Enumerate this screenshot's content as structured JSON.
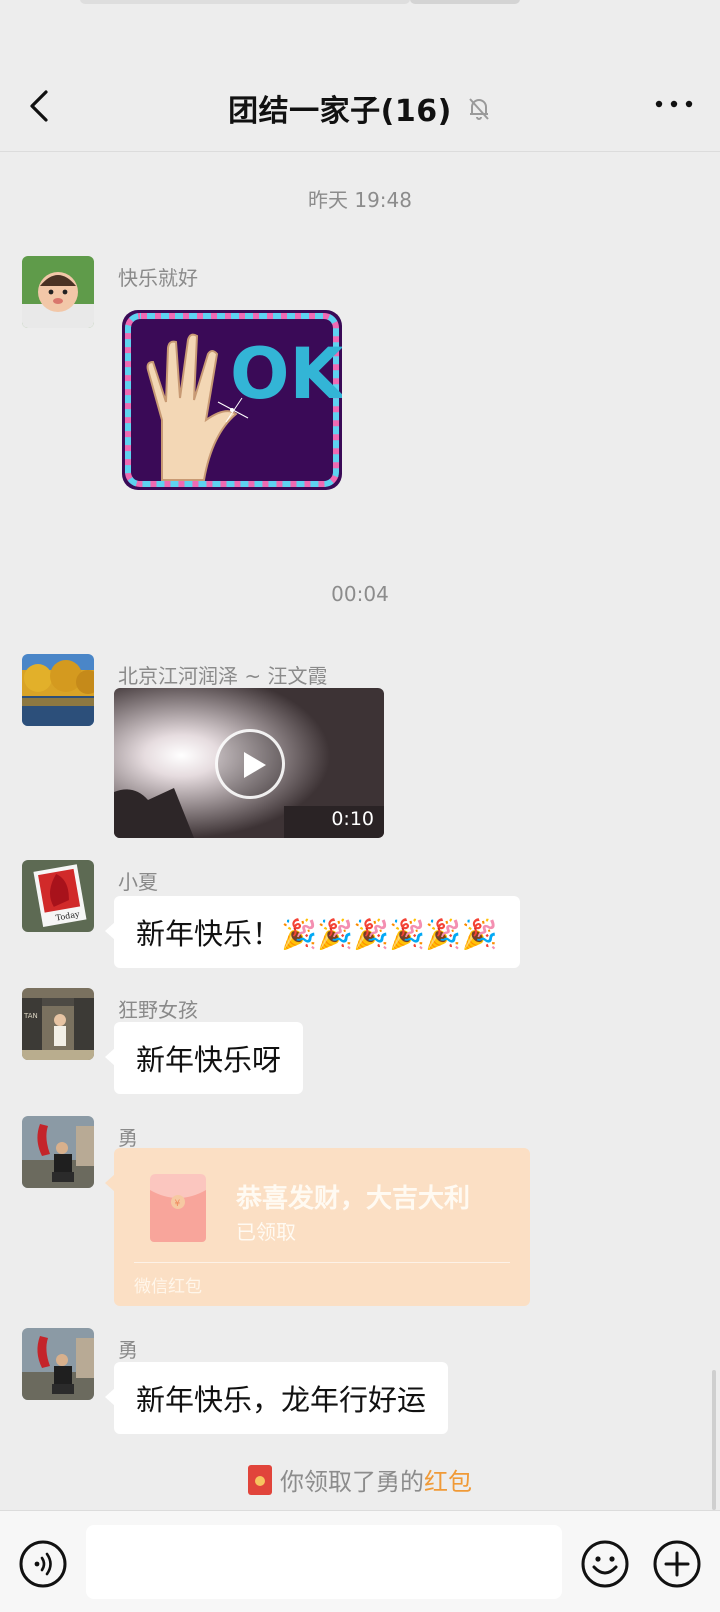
{
  "header": {
    "title": "团结一家子(16)",
    "icons": {
      "back": "chevron-left-icon",
      "mute": "bell-slash-icon",
      "more": "more-horizontal-icon"
    }
  },
  "messages": {
    "timestamp_1": "昨天 19:48",
    "msg1": {
      "sender": "快乐就好",
      "type": "sticker",
      "sticker_text": "OK"
    },
    "timestamp_2": "00:04",
    "msg2": {
      "sender": "北京江河润泽 ~ 汪文霞",
      "type": "video",
      "duration": "0:10"
    },
    "msg3": {
      "sender": "小夏",
      "text": "新年快乐！🎉🎉🎉🎉🎉🎉"
    },
    "msg4": {
      "sender": "狂野女孩",
      "text": "新年快乐呀"
    },
    "msg5": {
      "sender": "勇",
      "type": "red-packet",
      "title": "恭喜发财，大吉大利",
      "status": "已领取",
      "footer": "微信红包"
    },
    "msg6": {
      "sender": "勇",
      "text": "新年快乐，龙年行好运"
    }
  },
  "system": {
    "prefix": "你领取了勇的",
    "link": "红包"
  },
  "inputbar": {
    "placeholder": "",
    "icons": {
      "voice": "voice-icon",
      "emoji": "emoji-icon",
      "plus": "plus-icon"
    }
  },
  "colors": {
    "background": "#ededed",
    "bubble": "#ffffff",
    "red_packet": "#fbdfc4",
    "link": "#f09a37"
  }
}
